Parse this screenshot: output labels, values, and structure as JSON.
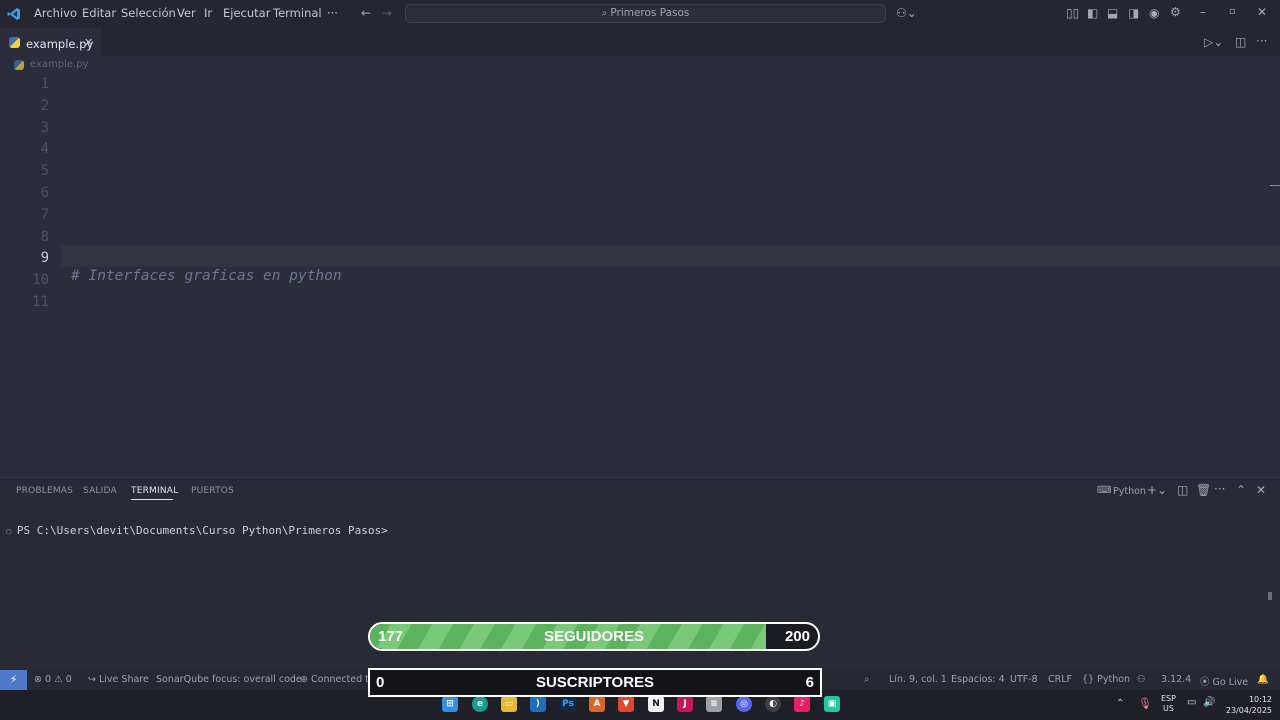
{
  "menu": [
    "Archivo",
    "Editar",
    "Selección",
    "Ver",
    "Ir",
    "Ejecutar",
    "Terminal",
    "···"
  ],
  "search": {
    "label": "Primeros Pasos"
  },
  "tab": {
    "filename": "example.py"
  },
  "breadcrumb": {
    "file": "example.py"
  },
  "editor": {
    "line_numbers": [
      "1",
      "2",
      "3",
      "4",
      "5",
      "6",
      "7",
      "8",
      "9",
      "10",
      "11"
    ],
    "current_line": 9,
    "comment_line": 10,
    "comment_text": "# Interfaces graficas en python"
  },
  "panel": {
    "tabs": [
      "PROBLEMAS",
      "SALIDA",
      "TERMINAL",
      "PUERTOS"
    ],
    "active_tab": "TERMINAL",
    "shell_label": "Python",
    "prompt": "PS C:\\Users\\devit\\Documents\\Curso Python\\Primeros Pasos>"
  },
  "status": {
    "errors": "0",
    "warnings": "0",
    "live_share": "Live Share",
    "sonar": "SonarQube focus: overall code",
    "discord": "Connected to Discord",
    "position": "Lín. 9, col. 1",
    "spaces": "Espacios: 4",
    "encoding": "UTF-8",
    "eol": "CRLF",
    "language": "Python",
    "python_version": "3.12.4",
    "go_live": "Go Live"
  },
  "taskbar": {
    "lang": "ESP",
    "region": "US",
    "time": "10:12",
    "date": "23/04/2025"
  },
  "overlay": {
    "followers": {
      "label": "SEGUIDORES",
      "current": "177",
      "goal": "200",
      "progress": 0.885
    },
    "subscribers": {
      "label": "SUSCRIPTORES",
      "current": "0",
      "goal": "6",
      "progress": 0
    }
  },
  "colors": {
    "accent": "#4d78cc",
    "editor_bg": "#2b2d3b",
    "progress_green": "#5db35d"
  }
}
